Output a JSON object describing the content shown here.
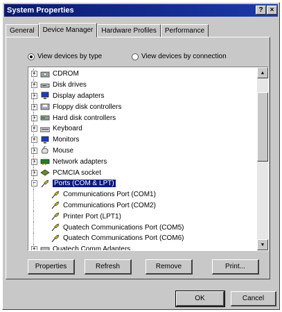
{
  "window": {
    "title": "System Properties",
    "help_btn": "?",
    "close_btn": "×"
  },
  "tabs": [
    {
      "label": "General",
      "active": false
    },
    {
      "label": "Device Manager",
      "active": true
    },
    {
      "label": "Hardware Profiles",
      "active": false
    },
    {
      "label": "Performance",
      "active": false
    }
  ],
  "view_options": {
    "by_type": "View devices by type",
    "by_connection": "View devices by connection",
    "selected": "by_type"
  },
  "tree": {
    "items": [
      {
        "label": "CDROM",
        "icon": "cdrom-icon",
        "expander": "+",
        "level": 0
      },
      {
        "label": "Disk drives",
        "icon": "disk-drive-icon",
        "expander": "+",
        "level": 0
      },
      {
        "label": "Display adapters",
        "icon": "monitor-icon",
        "expander": "+",
        "level": 0
      },
      {
        "label": "Floppy disk controllers",
        "icon": "floppy-controller-icon",
        "expander": "+",
        "level": 0
      },
      {
        "label": "Hard disk controllers",
        "icon": "hard-disk-controller-icon",
        "expander": "+",
        "level": 0
      },
      {
        "label": "Keyboard",
        "icon": "keyboard-icon",
        "expander": "+",
        "level": 0
      },
      {
        "label": "Monitors",
        "icon": "monitor-icon",
        "expander": "+",
        "level": 0
      },
      {
        "label": "Mouse",
        "icon": "mouse-icon",
        "expander": "+",
        "level": 0
      },
      {
        "label": "Network adapters",
        "icon": "network-adapter-icon",
        "expander": "+",
        "level": 0
      },
      {
        "label": "PCMCIA socket",
        "icon": "pcmcia-icon",
        "expander": "+",
        "level": 0
      },
      {
        "label": "Ports (COM & LPT)",
        "icon": "port-icon",
        "expander": "−",
        "level": 0,
        "selected": true
      },
      {
        "label": "Communications Port (COM1)",
        "icon": "port-icon",
        "level": 1
      },
      {
        "label": "Communications Port (COM2)",
        "icon": "port-icon",
        "level": 1
      },
      {
        "label": "Printer Port (LPT1)",
        "icon": "port-icon",
        "level": 1
      },
      {
        "label": "Quatech Communications Port (COM5)",
        "icon": "port-icon",
        "level": 1
      },
      {
        "label": "Quatech Communications Port (COM6)",
        "icon": "port-icon",
        "level": 1
      },
      {
        "label": "Quatech Comm Adapters",
        "icon": "adapter-icon",
        "expander": "+",
        "level": 0
      }
    ]
  },
  "buttons": {
    "properties": "Properties",
    "refresh": "Refresh",
    "remove": "Remove",
    "print": "Print...",
    "ok": "OK",
    "cancel": "Cancel"
  }
}
